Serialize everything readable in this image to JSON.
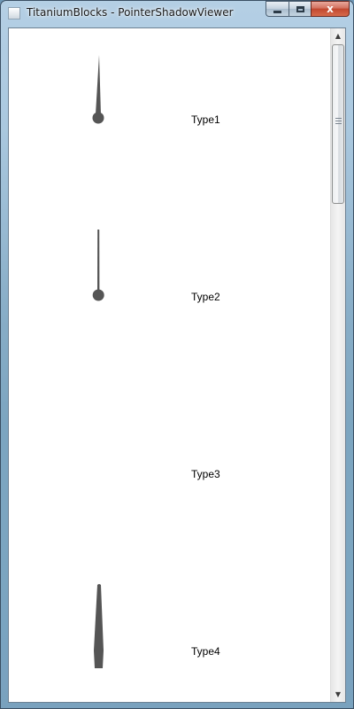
{
  "window": {
    "title": "TitaniumBlocks - PointerShadowViewer",
    "minimize_label": "",
    "maximize_label": "",
    "close_label": "x"
  },
  "pointers": [
    {
      "label": "Type1",
      "shape": "tapered-needle-with-round-base",
      "visible": true
    },
    {
      "label": "Type2",
      "shape": "thin-needle-with-round-base",
      "visible": true
    },
    {
      "label": "Type3",
      "shape": "none",
      "visible": false
    },
    {
      "label": "Type4",
      "shape": "wide-tapered-bar-with-pointed-base",
      "visible": true
    }
  ],
  "colors": {
    "pointer": "#555555",
    "client_background": "#ffffff",
    "label_text": "#000000"
  },
  "scrollbar": {
    "up_arrow": "▲",
    "down_arrow": "▼",
    "position_fraction": 0.0
  }
}
